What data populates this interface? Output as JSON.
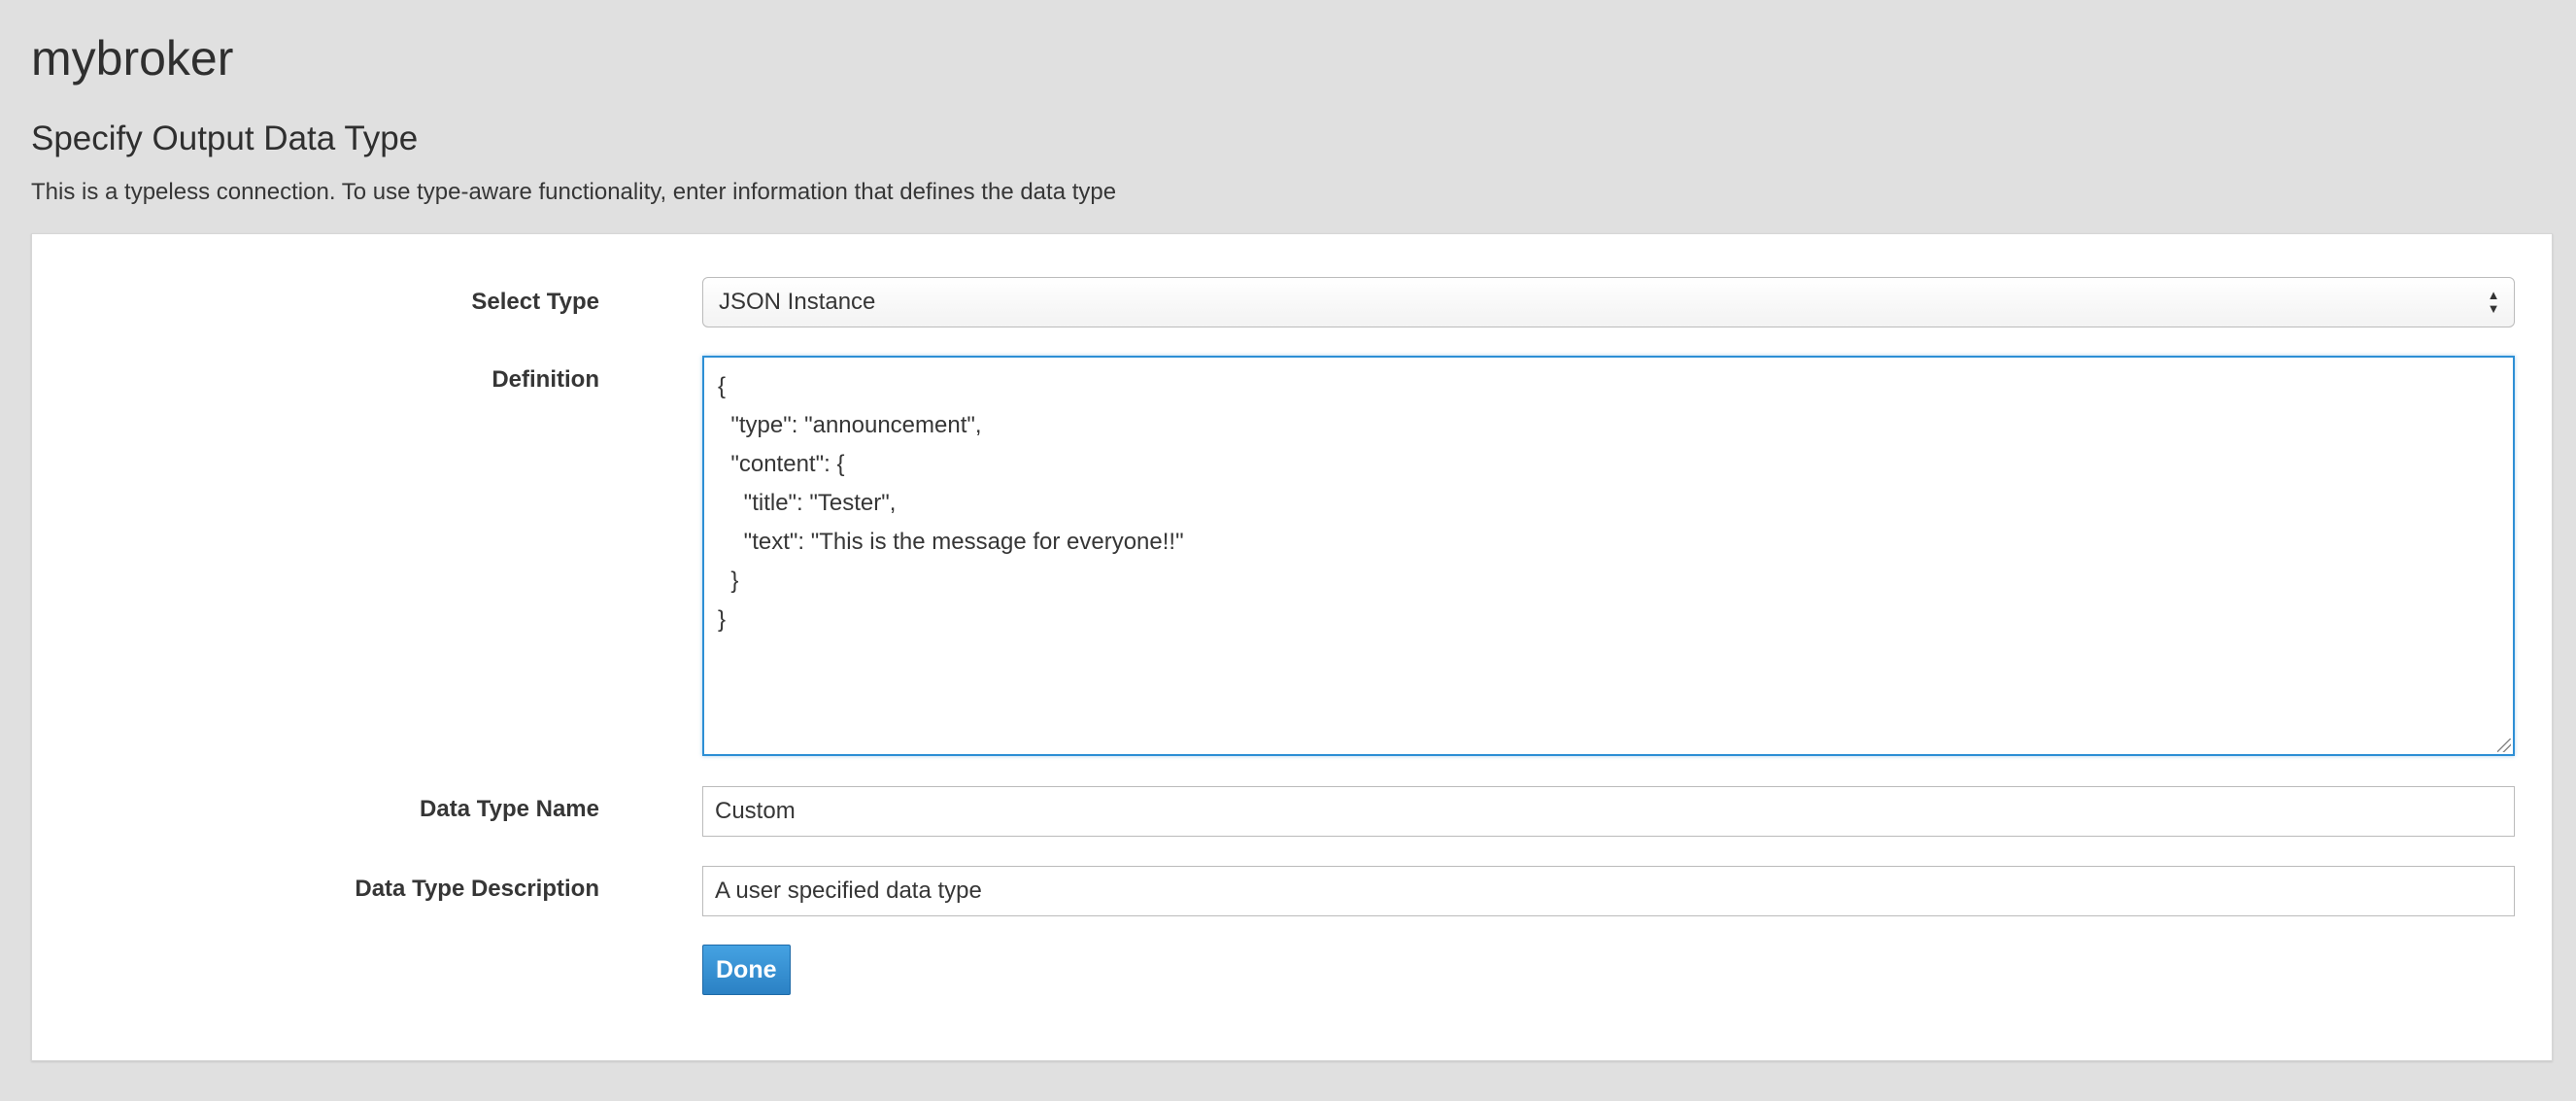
{
  "app": {
    "title": "mybroker"
  },
  "section": {
    "title": "Specify Output Data Type",
    "description": "This is a typeless connection. To use type-aware functionality, enter information that defines the data type"
  },
  "form": {
    "select_type": {
      "label": "Select Type",
      "value": "JSON Instance"
    },
    "definition": {
      "label": "Definition",
      "value": "{\n  \"type\": \"announcement\",\n  \"content\": {\n    \"title\": \"Tester\",\n    \"text\": \"This is the message for everyone!!\"\n  }\n}"
    },
    "data_type_name": {
      "label": "Data Type Name",
      "value": "Custom"
    },
    "data_type_description": {
      "label": "Data Type Description",
      "value": "A user specified data type"
    },
    "done_label": "Done"
  },
  "icons": {
    "select_arrows": "updown-chevron-icon",
    "resize": "resize-grip-icon"
  },
  "colors": {
    "background": "#e0e0e0",
    "card": "#ffffff",
    "focus_border": "#2d8fd5",
    "primary_button": "#2b81c4"
  }
}
